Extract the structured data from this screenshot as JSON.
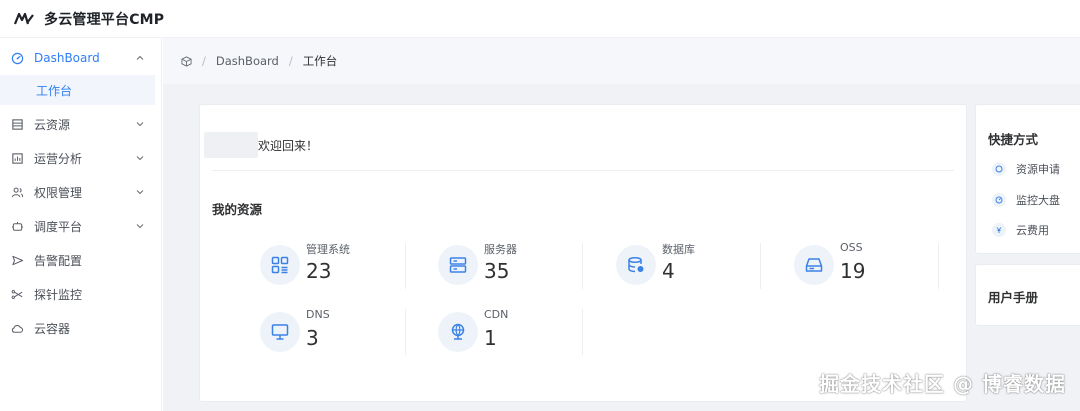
{
  "app": {
    "title": "多云管理平台CMP"
  },
  "sidebar": {
    "items": [
      {
        "label": "DashBoard",
        "icon": "dashboard-icon",
        "expanded": true
      },
      {
        "label": "云资源",
        "icon": "cloud-resource-icon"
      },
      {
        "label": "运营分析",
        "icon": "analysis-icon"
      },
      {
        "label": "权限管理",
        "icon": "users-icon"
      },
      {
        "label": "调度平台",
        "icon": "scheduler-icon"
      },
      {
        "label": "告警配置",
        "icon": "send-icon"
      },
      {
        "label": "探针监控",
        "icon": "probe-icon"
      },
      {
        "label": "云容器",
        "icon": "cloud-icon"
      }
    ],
    "sub_active": "工作台"
  },
  "breadcrumb": {
    "items": [
      "DashBoard",
      "工作台"
    ]
  },
  "welcome": {
    "text": "欢迎回来！"
  },
  "resources": {
    "title": "我的资源",
    "items": [
      {
        "label": "管理系统",
        "count": "23",
        "icon": "grid-icon"
      },
      {
        "label": "服务器",
        "count": "35",
        "icon": "server-icon"
      },
      {
        "label": "数据库",
        "count": "4",
        "icon": "database-icon"
      },
      {
        "label": "OSS",
        "count": "19",
        "icon": "storage-icon"
      },
      {
        "label": "DNS",
        "count": "3",
        "icon": "monitor-icon"
      },
      {
        "label": "CDN",
        "count": "1",
        "icon": "globe-icon"
      }
    ]
  },
  "quick": {
    "title": "快捷方式",
    "items": [
      {
        "label": "资源申请",
        "icon": "request-icon"
      },
      {
        "label": "监控大盘",
        "icon": "gauge-icon"
      },
      {
        "label": "云费用",
        "icon": "yuan-icon"
      }
    ]
  },
  "manual": {
    "title": "用户手册"
  },
  "watermark": {
    "text": "掘金技术社区 @ 博睿数据"
  },
  "colors": {
    "accent": "#2f7ff5",
    "icon": "#3b82e6",
    "background": "#f0f2f5"
  }
}
